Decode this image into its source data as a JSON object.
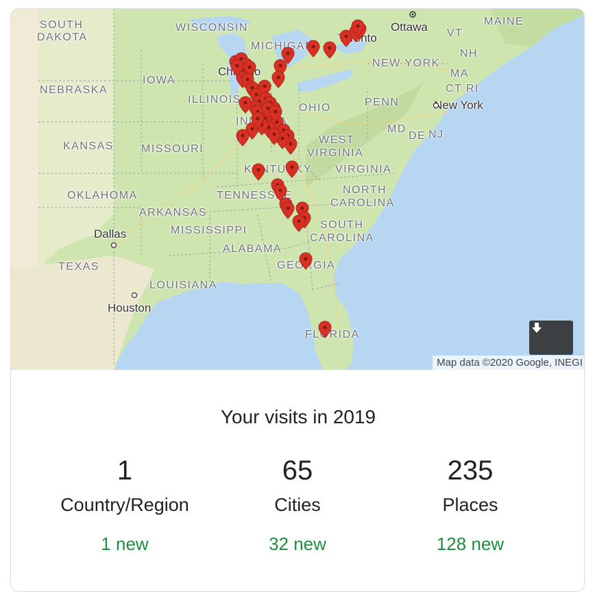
{
  "map": {
    "labels": {
      "south_dakota_1": "SOUTH",
      "south_dakota_2": "DAKOTA",
      "wisconsin": "WISCONSIN",
      "michigan": "MICHIGAN",
      "ottawa": "Ottawa",
      "toronto": "Toronto",
      "vt": "VT",
      "maine": "MAINE",
      "nh": "NH",
      "new_york_state": "NEW YORK",
      "ma": "MA",
      "ct_ri": "CT RI",
      "nebraska": "NEBRASKA",
      "iowa": "IOWA",
      "chicago": "Chicago",
      "illinois": "ILLINOIS",
      "ohio": "OHIO",
      "penn": "PENN",
      "new_york_city": "New York",
      "indiana": "INDIANA",
      "kansas": "KANSAS",
      "missouri": "MISSOURI",
      "md": "MD",
      "de": "DE",
      "nj": "NJ",
      "west": "WEST",
      "virginia_wv": "VIRGINIA",
      "kentucky": "KENTUCKY",
      "virginia": "VIRGINIA",
      "oklahoma": "OKLAHOMA",
      "tennessee": "TENNESSEE",
      "north": "NORTH",
      "carolina_n": "CAROLINA",
      "arkansas": "ARKANSAS",
      "mississippi": "MISSISSIPPI",
      "south": "SOUTH",
      "carolina_s": "CAROLINA",
      "dallas": "Dallas",
      "alabama": "ALABAMA",
      "texas": "TEXAS",
      "georgia": "GEORGIA",
      "louisiana": "LOUISIANA",
      "houston": "Houston",
      "florida": "FLORIDA"
    },
    "attribution": "Map data ©2020 Google, INEGI",
    "download_icon": "download-icon",
    "colors": {
      "water": "#b6d6f2",
      "land": "#cfe5b0",
      "dry_land": "#f3ead3",
      "pin": "#d93025"
    }
  },
  "stats": {
    "title": "Your visits in 2019",
    "items": [
      {
        "number": "1",
        "label": "Country/Region",
        "new": "1 new"
      },
      {
        "number": "65",
        "label": "Cities",
        "new": "32 new"
      },
      {
        "number": "235",
        "label": "Places",
        "new": "128 new"
      }
    ],
    "new_color": "#1e8e3e"
  }
}
